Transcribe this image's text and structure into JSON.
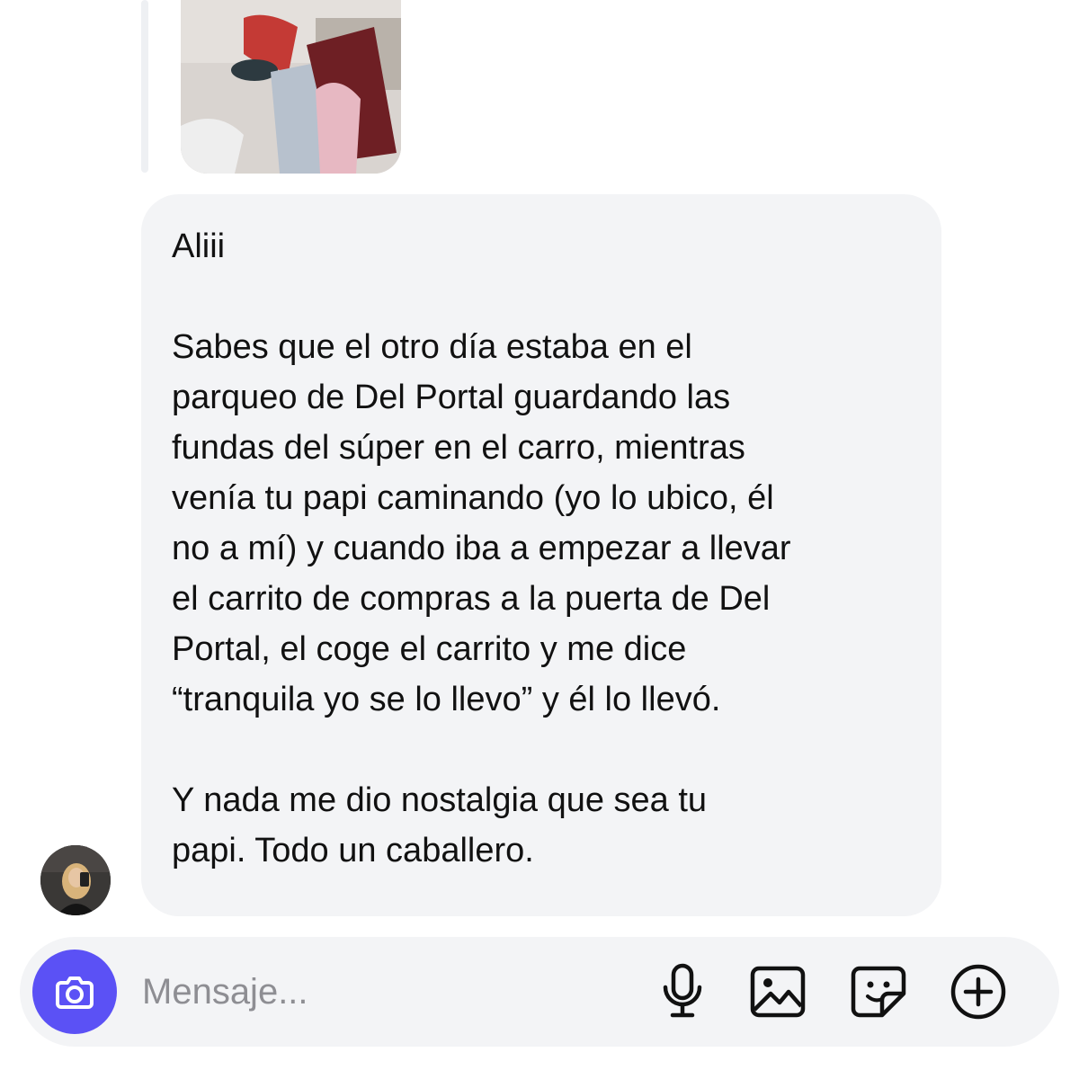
{
  "message": {
    "paragraphs": [
      "Aliii",
      "Sabes que el otro día estaba en el\nparqueo de Del Portal guardando las\nfundas del súper en el carro, mientras\nvenía tu papi caminando (yo lo ubico, él\nno a mí) y cuando iba a empezar a llevar\nel carrito de compras a la puerta de Del\nPortal, el coge el carrito y me dice\n“tranquila yo se lo llevo” y él lo llevó.",
      "Y nada me dio nostalgia que sea tu\npapi. Todo un caballero."
    ]
  },
  "composer": {
    "placeholder": "Mensaje...",
    "value": ""
  },
  "icons": {
    "camera": "camera-icon",
    "microphone": "microphone-icon",
    "gallery": "image-gallery-icon",
    "sticker": "sticker-icon",
    "add": "plus-circle-icon"
  },
  "colors": {
    "accent": "#5b51f5",
    "bubble": "#f3f4f6",
    "text": "#111111",
    "placeholder": "#8e8e93"
  }
}
